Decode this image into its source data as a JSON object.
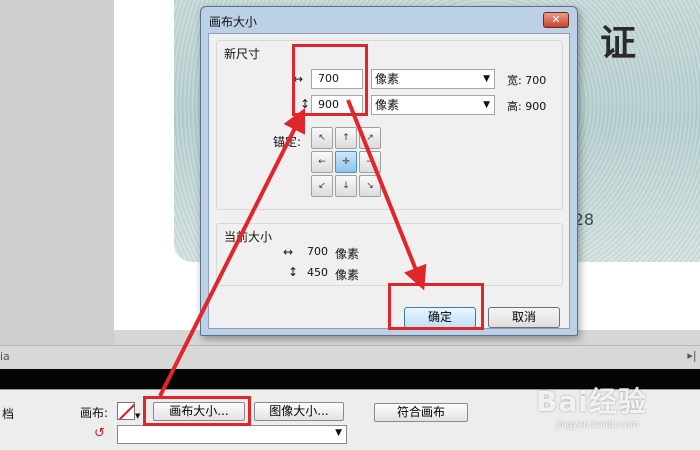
{
  "background": {
    "card_char": "证",
    "card_number": "28"
  },
  "workspace": {
    "scroll_left_label": "ia"
  },
  "dialog": {
    "title": "画布大小",
    "close_glyph": "✕",
    "new_size": {
      "group_title": "新尺寸",
      "width_value": "700",
      "height_value": "900",
      "width_unit": "像素",
      "height_unit": "像素",
      "width_result": "宽: 700",
      "height_result": "高: 900",
      "anchor_label": "锚定:"
    },
    "current_size": {
      "group_title": "当前大小",
      "width_value": "700",
      "height_value": "450",
      "unit": "像素"
    },
    "ok_label": "确定",
    "cancel_label": "取消"
  },
  "bottom_panel": {
    "doc_label": "档",
    "canvas_label": "画布:",
    "canvas_size_button": "画布大小...",
    "image_size_button": "图像大小...",
    "fit_canvas_button": "符合画布"
  },
  "watermark": {
    "text": "Bai经验",
    "sub": "jingyan.baidu.com"
  },
  "icons": {
    "width_arrow": "↔",
    "height_arrow": "↕",
    "dropdown": "▼",
    "rotate": "↺"
  },
  "colors": {
    "highlight": "#e0262b",
    "dialog_frame": "#bcd0e6",
    "anchor_selected": "#8cc3ec"
  }
}
